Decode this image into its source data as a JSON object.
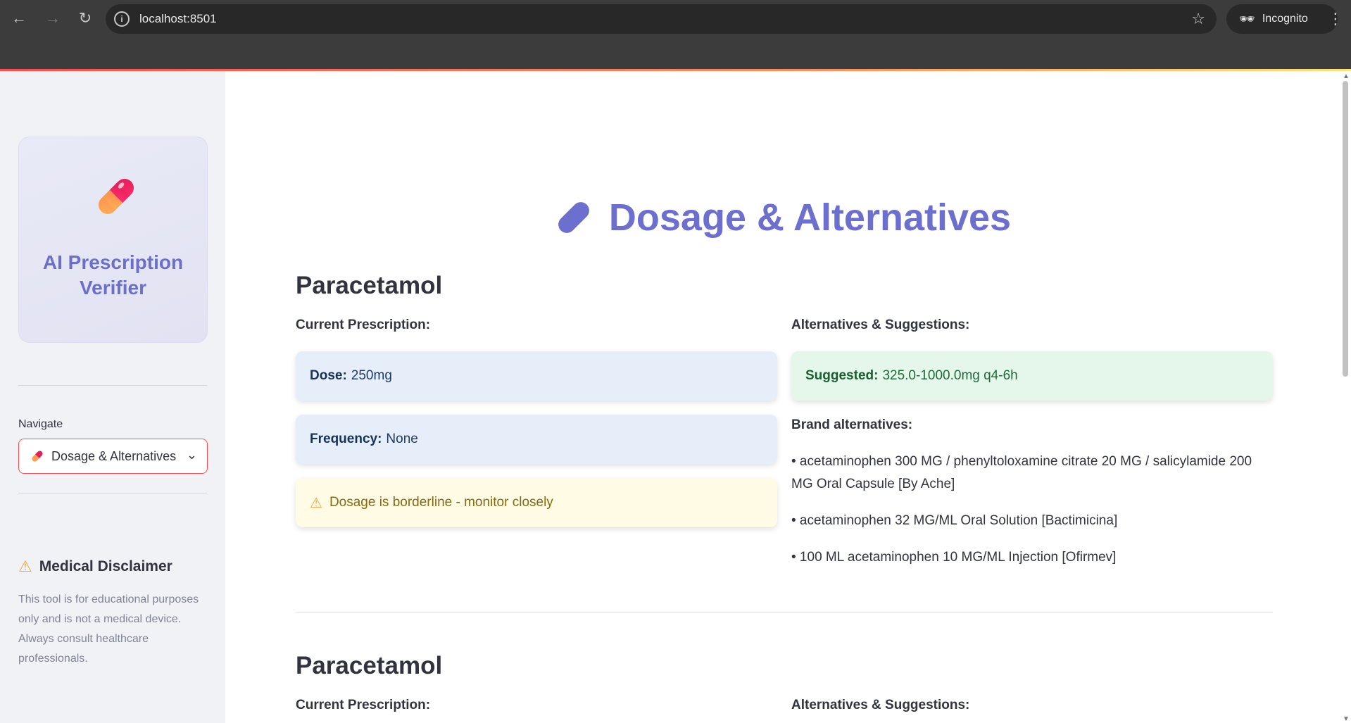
{
  "browser": {
    "url": "localhost:8501",
    "profile_label": "Incognito",
    "icons": [
      "back-arrow-icon",
      "forward-arrow-icon",
      "reload-icon",
      "site-info-icon",
      "star-icon",
      "incognito-icon",
      "kebab-menu-icon"
    ]
  },
  "sidebar": {
    "app_title": "AI Prescription Verifier",
    "nav_label": "Navigate",
    "nav_selected": "Dosage & Alternatives",
    "disclaimer_title": "Medical Disclaimer",
    "disclaimer_text": "This tool is for educational purposes only and is not a medical device. Always consult healthcare professionals."
  },
  "main": {
    "title": "Dosage & Alternatives",
    "sections": [
      {
        "drug": "Paracetamol",
        "current_label": "Current Prescription:",
        "alternatives_label": "Alternatives & Suggestions:",
        "dose_label": "Dose:",
        "dose_value": "250mg",
        "frequency_label": "Frequency:",
        "frequency_value": "None",
        "warning": "Dosage is borderline - monitor closely",
        "suggested_label": "Suggested:",
        "suggested_value": "325.0-1000.0mg q4-6h",
        "brand_label": "Brand alternatives:",
        "brands": [
          "• acetaminophen 300 MG / phenyltoloxamine citrate 20 MG / salicylamide 200 MG Oral Capsule [By Ache]",
          "• acetaminophen 32 MG/ML Oral Solution [Bactimicina]",
          "• 100 ML acetaminophen 10 MG/ML Injection [Ofirmev]"
        ]
      },
      {
        "drug": "Paracetamol",
        "current_label": "Current Prescription:",
        "alternatives_label": "Alternatives & Suggestions:"
      }
    ]
  },
  "colors": {
    "accent": "#6c6fcd",
    "select_border": "#ff4b4b",
    "info_card": "#e6eefa",
    "success_card": "#e5f6ea",
    "warning_card": "#fffbe5"
  }
}
